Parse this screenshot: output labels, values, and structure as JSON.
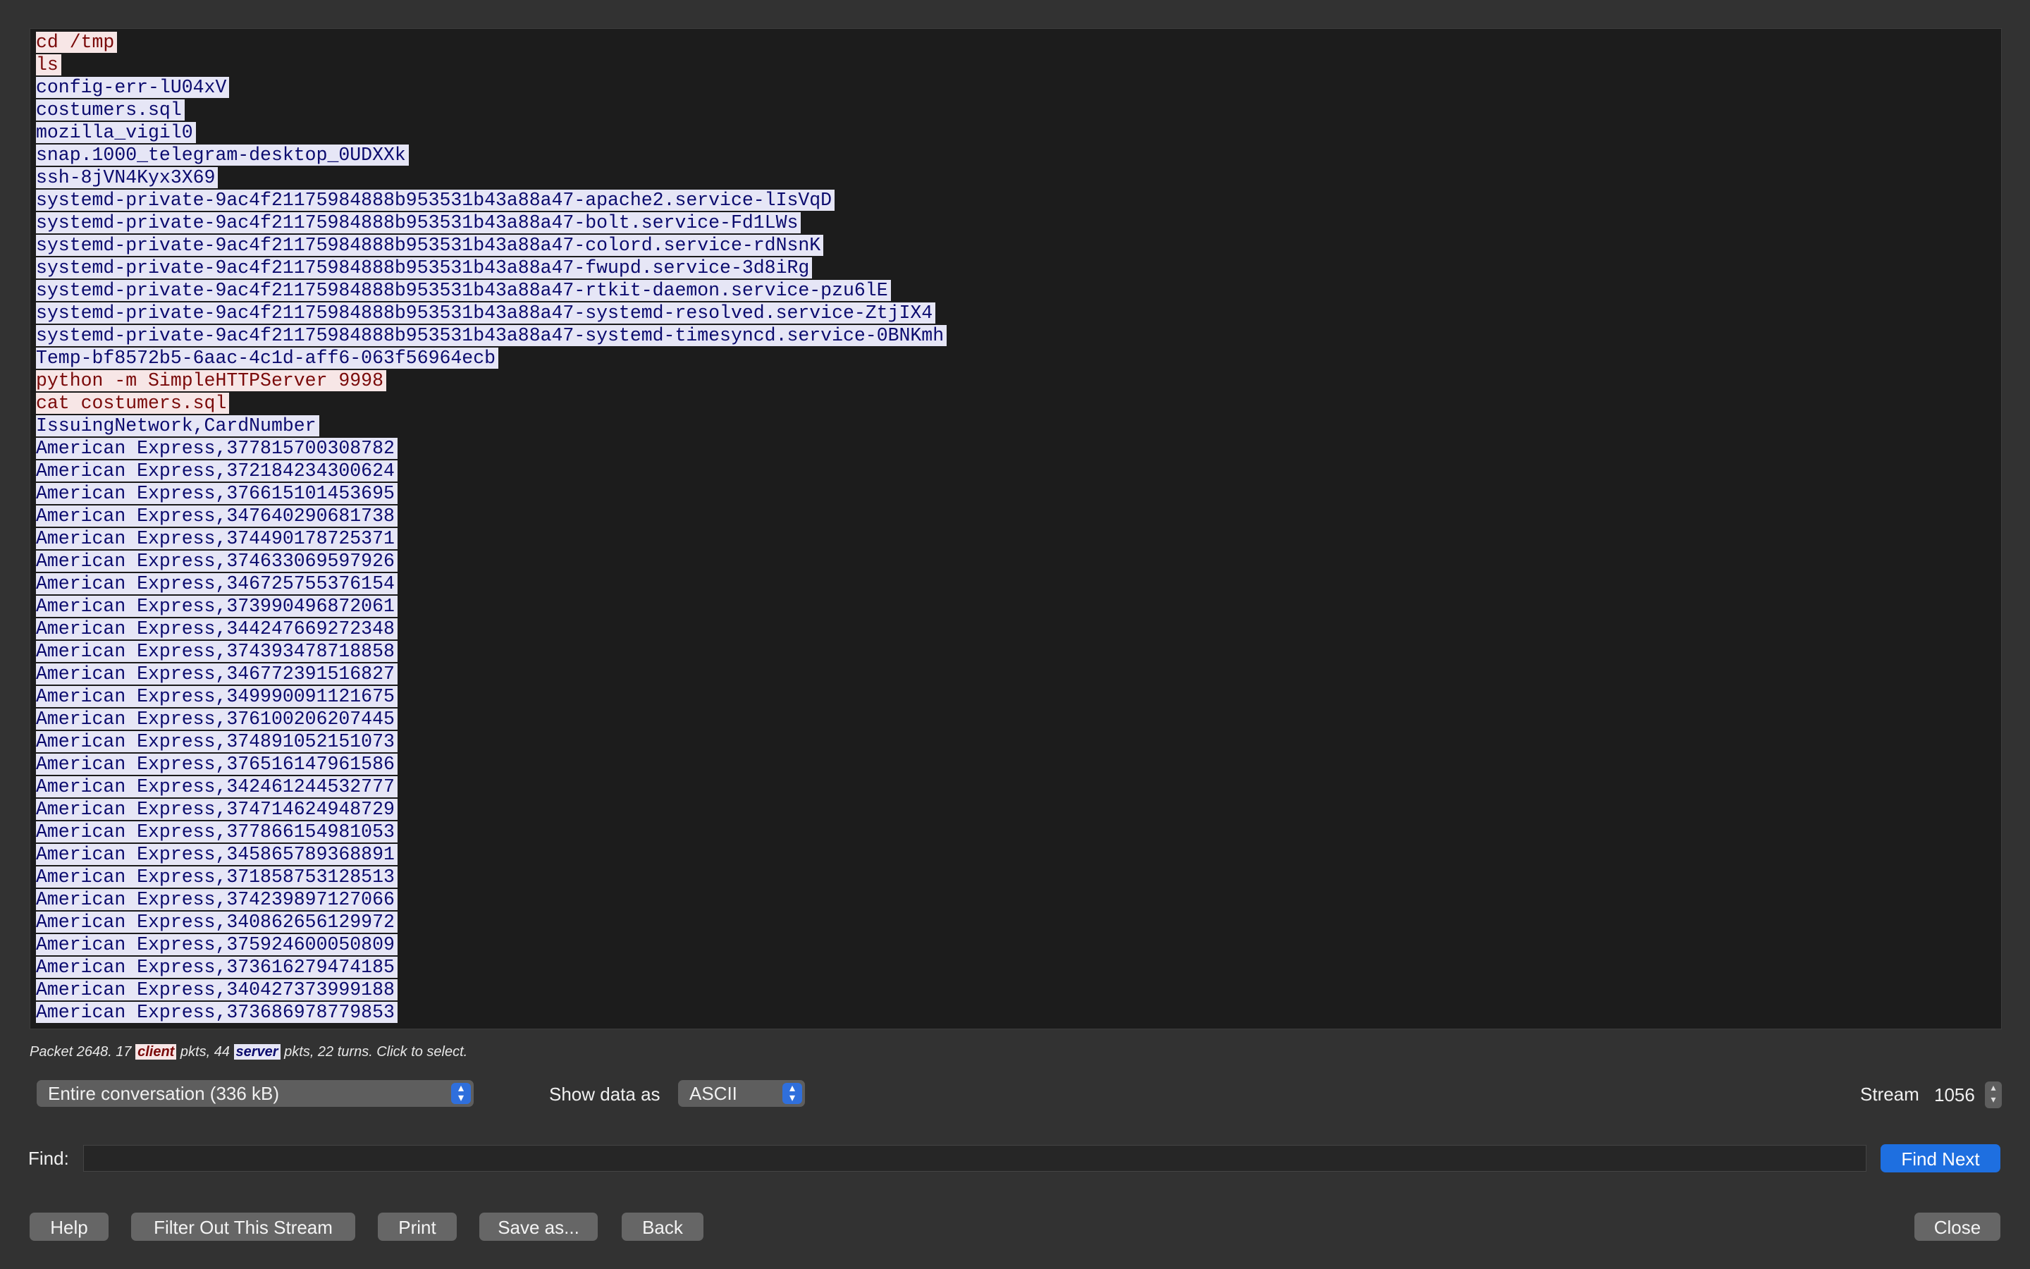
{
  "stream_lines": [
    {
      "dir": "client",
      "text": "cd /tmp"
    },
    {
      "dir": "client",
      "text": "ls"
    },
    {
      "dir": "server",
      "text": "config-err-lU04xV"
    },
    {
      "dir": "server",
      "text": "costumers.sql"
    },
    {
      "dir": "server",
      "text": "mozilla_vigil0"
    },
    {
      "dir": "server",
      "text": "snap.1000_telegram-desktop_0UDXXk"
    },
    {
      "dir": "server",
      "text": "ssh-8jVN4Kyx3X69"
    },
    {
      "dir": "server",
      "text": "systemd-private-9ac4f21175984888b953531b43a88a47-apache2.service-lIsVqD"
    },
    {
      "dir": "server",
      "text": "systemd-private-9ac4f21175984888b953531b43a88a47-bolt.service-Fd1LWs"
    },
    {
      "dir": "server",
      "text": "systemd-private-9ac4f21175984888b953531b43a88a47-colord.service-rdNsnK"
    },
    {
      "dir": "server",
      "text": "systemd-private-9ac4f21175984888b953531b43a88a47-fwupd.service-3d8iRg"
    },
    {
      "dir": "server",
      "text": "systemd-private-9ac4f21175984888b953531b43a88a47-rtkit-daemon.service-pzu6lE"
    },
    {
      "dir": "server",
      "text": "systemd-private-9ac4f21175984888b953531b43a88a47-systemd-resolved.service-ZtjIX4"
    },
    {
      "dir": "server",
      "text": "systemd-private-9ac4f21175984888b953531b43a88a47-systemd-timesyncd.service-0BNKmh"
    },
    {
      "dir": "server",
      "text": "Temp-bf8572b5-6aac-4c1d-aff6-063f56964ecb"
    },
    {
      "dir": "client",
      "text": "python -m SimpleHTTPServer 9998"
    },
    {
      "dir": "client",
      "text": "cat costumers.sql"
    },
    {
      "dir": "server",
      "text": "IssuingNetwork,CardNumber"
    },
    {
      "dir": "server",
      "text": "American Express,377815700308782"
    },
    {
      "dir": "server",
      "text": "American Express,372184234300624"
    },
    {
      "dir": "server",
      "text": "American Express,376615101453695"
    },
    {
      "dir": "server",
      "text": "American Express,347640290681738"
    },
    {
      "dir": "server",
      "text": "American Express,374490178725371"
    },
    {
      "dir": "server",
      "text": "American Express,374633069597926"
    },
    {
      "dir": "server",
      "text": "American Express,346725755376154"
    },
    {
      "dir": "server",
      "text": "American Express,373990496872061"
    },
    {
      "dir": "server",
      "text": "American Express,344247669272348"
    },
    {
      "dir": "server",
      "text": "American Express,374393478718858"
    },
    {
      "dir": "server",
      "text": "American Express,346772391516827"
    },
    {
      "dir": "server",
      "text": "American Express,349990091121675"
    },
    {
      "dir": "server",
      "text": "American Express,376100206207445"
    },
    {
      "dir": "server",
      "text": "American Express,374891052151073"
    },
    {
      "dir": "server",
      "text": "American Express,376516147961586"
    },
    {
      "dir": "server",
      "text": "American Express,342461244532777"
    },
    {
      "dir": "server",
      "text": "American Express,374714624948729"
    },
    {
      "dir": "server",
      "text": "American Express,377866154981053"
    },
    {
      "dir": "server",
      "text": "American Express,345865789368891"
    },
    {
      "dir": "server",
      "text": "American Express,371858753128513"
    },
    {
      "dir": "server",
      "text": "American Express,374239897127066"
    },
    {
      "dir": "server",
      "text": "American Express,340862656129972"
    },
    {
      "dir": "server",
      "text": "American Express,375924600050809"
    },
    {
      "dir": "server",
      "text": "American Express,373616279474185"
    },
    {
      "dir": "server",
      "text": "American Express,340427373999188"
    },
    {
      "dir": "server",
      "text": "American Express,373686978779853"
    }
  ],
  "status": {
    "prefix": "Packet 2648. 17 ",
    "client_tag": "client",
    "middle": " pkts, 44 ",
    "server_tag": "server",
    "suffix": " pkts, 22 turns. Click to select."
  },
  "controls": {
    "conversation_select": "Entire conversation (336 kB)",
    "show_data_as_label": "Show data as",
    "show_data_as_value": "ASCII",
    "stream_label": "Stream",
    "stream_value": "1056"
  },
  "find": {
    "label": "Find:",
    "value": "",
    "button": "Find Next"
  },
  "buttons": {
    "help": "Help",
    "filter_out": "Filter Out This Stream",
    "print": "Print",
    "save_as": "Save as...",
    "back": "Back",
    "close": "Close"
  },
  "colors": {
    "client_bg": "#f7e6e6",
    "client_fg": "#7a0a0a",
    "server_bg": "#e6e6f6",
    "server_fg": "#0b0b6e",
    "accent": "#1e6fe0"
  }
}
